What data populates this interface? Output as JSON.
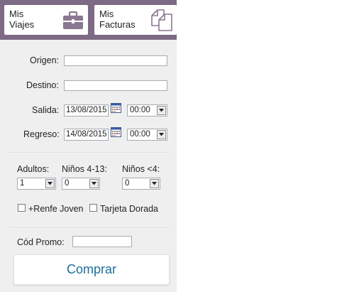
{
  "nav": {
    "viajes": {
      "label_line1": "Mis",
      "label_line2": "Viajes",
      "icon": "briefcase-icon"
    },
    "facturas": {
      "label_line1": "Mis",
      "label_line2": "Facturas",
      "icon": "documents-icon"
    }
  },
  "form": {
    "origen": {
      "label": "Origen:",
      "value": ""
    },
    "destino": {
      "label": "Destino:",
      "value": ""
    },
    "salida": {
      "label": "Salida:",
      "date": "13/08/2015",
      "time": "00:00"
    },
    "regreso": {
      "label": "Regreso:",
      "date": "14/08/2015",
      "time": "00:00"
    }
  },
  "passengers": {
    "adultos": {
      "label": "Adultos:",
      "value": "1"
    },
    "ninos_4_13": {
      "label": "Niños 4-13:",
      "value": "0"
    },
    "ninos_menor_4": {
      "label": "Niños <4:",
      "value": "0"
    }
  },
  "options": {
    "renfe_joven": {
      "label": "+Renfe Joven",
      "checked": false
    },
    "tarjeta_dorada": {
      "label": "Tarjeta Dorada",
      "checked": false
    }
  },
  "promo": {
    "label": "Cód Promo:",
    "value": ""
  },
  "buy_button": {
    "label": "Comprar"
  },
  "colors": {
    "header": "#7d6a85",
    "panel": "#efefef",
    "button_text": "#1b6f97"
  }
}
